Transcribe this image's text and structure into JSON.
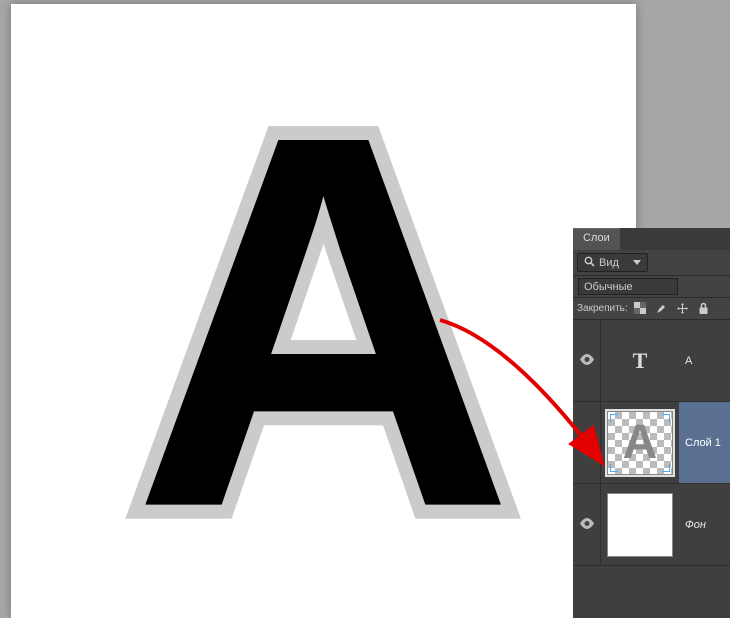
{
  "canvas": {
    "letter": "A"
  },
  "panel": {
    "tab_label": "Слои",
    "filter_label": "Вид",
    "blend_mode": "Обычные",
    "lock_label": "Закрепить:"
  },
  "layers": [
    {
      "name": "A",
      "type": "text",
      "visible": true,
      "selected": false,
      "thumb_letter": "T"
    },
    {
      "name": "Слой 1",
      "type": "raster",
      "visible": true,
      "selected": true,
      "thumb_letter": "A"
    },
    {
      "name": "Фон",
      "type": "background",
      "visible": true,
      "selected": false,
      "thumb_letter": ""
    }
  ]
}
